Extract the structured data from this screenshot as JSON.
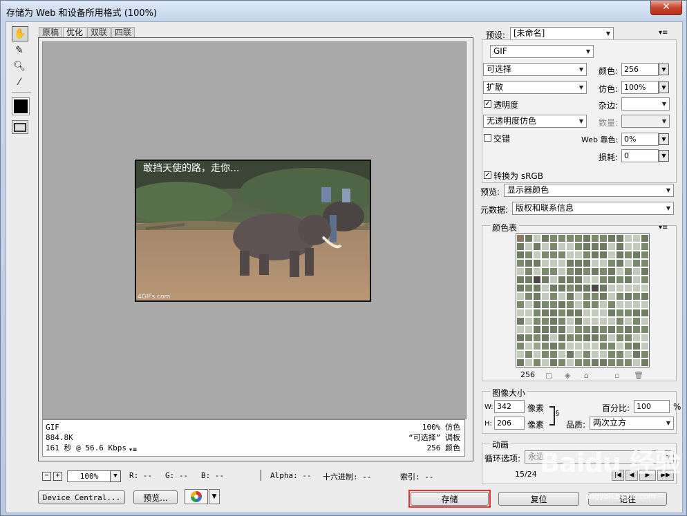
{
  "window": {
    "title": "存储为 Web 和设备所用格式 (100%)",
    "close_glyph": "✕"
  },
  "tabs": [
    {
      "label": "原稿"
    },
    {
      "label": "优化"
    },
    {
      "label": "双联"
    },
    {
      "label": "四联"
    }
  ],
  "image": {
    "caption": "敢挡天使的路，走你...",
    "watermark": "4GIFs.com"
  },
  "info": {
    "format": "GIF",
    "size": "884.8K",
    "time": "161 秒 @ 56.6 Kbps",
    "menu_glyph": "▾≡",
    "dither_line": "100% 仿色",
    "palette_line": "“可选择” 调板",
    "colors_line": "256 颜色"
  },
  "status": {
    "zoom_out": "−",
    "zoom_in": "+",
    "zoom": "100%",
    "r": "R: --",
    "g": "G: --",
    "b": "B: --",
    "alpha": "Alpha: --",
    "hex": "十六进制: --",
    "index": "索引: --"
  },
  "buttons": {
    "device_central": "Device Central...",
    "preview": "预览...",
    "save": "存储",
    "reset": "复位",
    "remember": "记住"
  },
  "settings": {
    "preset_label": "预设:",
    "preset_value": "[未命名]",
    "format": "GIF",
    "reduction": "可选择",
    "dither_algo": "扩散",
    "transparency_label": "透明度",
    "transparency_checked": true,
    "transparency_dither": "无透明度仿色",
    "interlaced_label": "交错",
    "interlaced_checked": false,
    "colors_label": "颜色:",
    "colors_value": "256",
    "dither_label": "仿色:",
    "dither_value": "100%",
    "matte_label": "杂边:",
    "amount_label": "数量:",
    "websnap_label": "Web 靠色:",
    "websnap_value": "0%",
    "lossy_label": "损耗:",
    "lossy_value": "0",
    "convert_srgb_label": "转换为 sRGB",
    "convert_srgb_checked": true,
    "preview_label": "预览:",
    "preview_value": "显示器颜色",
    "metadata_label": "元数据:",
    "metadata_value": "版权和联系信息"
  },
  "color_table": {
    "title": "颜色表",
    "count": "256"
  },
  "image_size": {
    "title": "图像大小",
    "w_label": "W:",
    "w_value": "342",
    "h_label": "H:",
    "h_value": "206",
    "unit": "像素",
    "percent_label": "百分比:",
    "percent_value": "100",
    "percent_unit": "%",
    "quality_label": "品质:",
    "quality_value": "两次立方"
  },
  "animation": {
    "title": "动画",
    "loop_label": "循环选项:",
    "loop_value": "永远",
    "frame": "15/24"
  },
  "overlay": {
    "brand": "Baidu 经验",
    "url": "jingyan.baidu.com"
  },
  "colors": {
    "accent_highlight": "#e33333",
    "canvas_gray": "#a9a9a9"
  }
}
